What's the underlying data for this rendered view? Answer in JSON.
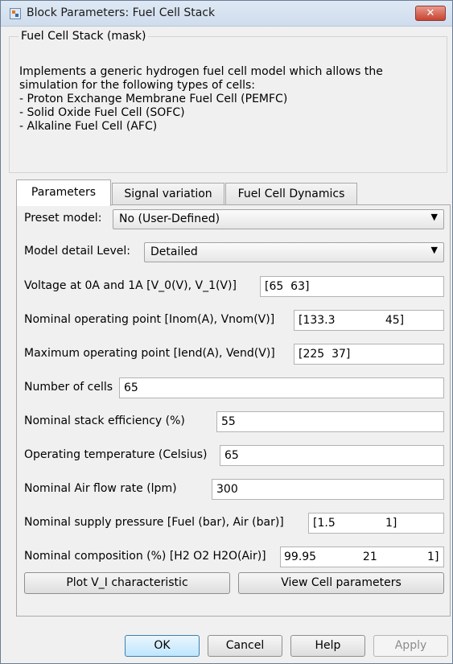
{
  "window": {
    "title": "Block Parameters: Fuel Cell Stack",
    "close_label": "✕"
  },
  "mask": {
    "title": "Fuel Cell Stack (mask)",
    "description": [
      "Implements a generic hydrogen fuel cell model which allows the",
      "simulation for the following types of cells:",
      "- Proton Exchange Membrane Fuel Cell (PEMFC)",
      "- Solid Oxide Fuel Cell (SOFC)",
      "- Alkaline Fuel Cell (AFC)"
    ]
  },
  "tabs": [
    {
      "label": "Parameters",
      "active": true
    },
    {
      "label": "Signal variation",
      "active": false
    },
    {
      "label": "Fuel Cell Dynamics",
      "active": false
    }
  ],
  "params": {
    "preset_model": {
      "label": "Preset model:",
      "value": "No (User-Defined)"
    },
    "model_detail": {
      "label": "Model detail Level:",
      "value": "Detailed"
    },
    "voltage": {
      "label": "Voltage at 0A and 1A [V_0(V), V_1(V)]",
      "value": "[65  63]"
    },
    "nominal_op": {
      "label": "Nominal operating point [Inom(A), Vnom(V)]",
      "value": "[133.3              45]"
    },
    "max_op": {
      "label": "Maximum operating point [Iend(A), Vend(V)]",
      "value": "[225  37]"
    },
    "cells": {
      "label": "Number of cells",
      "value": "65"
    },
    "efficiency": {
      "label": "Nominal stack efficiency (%)",
      "value": "55"
    },
    "temperature": {
      "label": "Operating temperature (Celsius)",
      "value": "65"
    },
    "air_flow": {
      "label": "Nominal Air flow rate (lpm)",
      "value": "300"
    },
    "pressure": {
      "label": "Nominal supply pressure [Fuel (bar), Air (bar)]",
      "value": "[1.5              1]"
    },
    "composition": {
      "label": "Nominal composition (%) [H2 O2 H2O(Air)]",
      "value": "99.95             21              1]"
    }
  },
  "actions": {
    "plot_vi": "Plot V_I characteristic",
    "view_cell": "View Cell parameters"
  },
  "footer": {
    "ok": "OK",
    "cancel": "Cancel",
    "help": "Help",
    "apply": "Apply"
  }
}
